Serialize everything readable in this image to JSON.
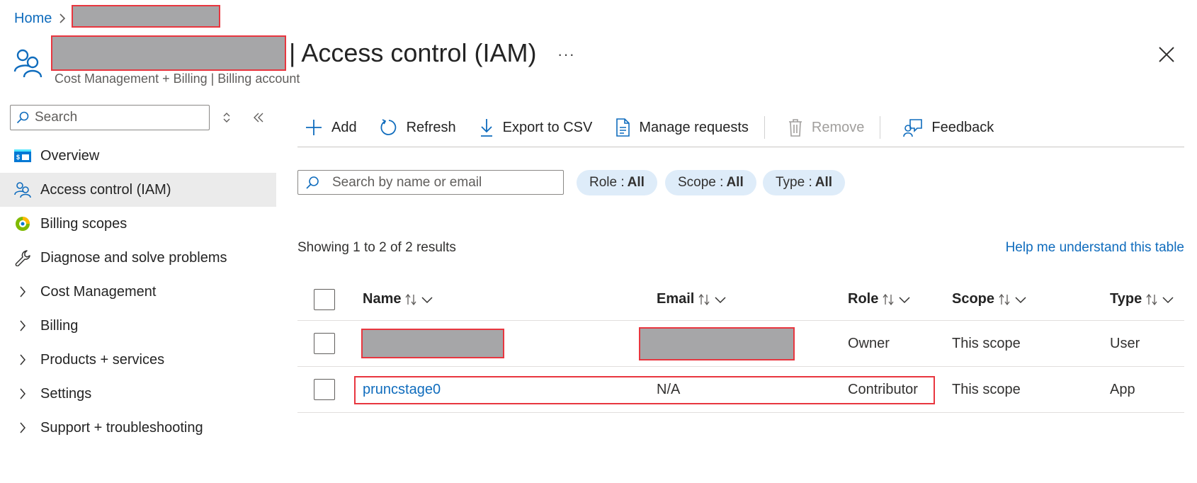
{
  "breadcrumb": {
    "home": "Home"
  },
  "header": {
    "title": "| Access control (IAM)",
    "more": "···",
    "subtitle": "Cost Management + Billing | Billing account"
  },
  "sidebar": {
    "search_placeholder": "Search",
    "items": [
      {
        "label": "Overview",
        "icon": "overview-icon"
      },
      {
        "label": "Access control (IAM)",
        "icon": "people-icon",
        "active": true
      },
      {
        "label": "Billing scopes",
        "icon": "billing-scopes-icon"
      },
      {
        "label": "Diagnose and solve problems",
        "icon": "wrench-icon"
      },
      {
        "label": "Cost Management",
        "icon": "chevron-right-icon"
      },
      {
        "label": "Billing",
        "icon": "chevron-right-icon"
      },
      {
        "label": "Products + services",
        "icon": "chevron-right-icon"
      },
      {
        "label": "Settings",
        "icon": "chevron-right-icon"
      },
      {
        "label": "Support + troubleshooting",
        "icon": "chevron-right-icon"
      }
    ]
  },
  "toolbar": {
    "add": "Add",
    "refresh": "Refresh",
    "export": "Export to CSV",
    "manage": "Manage requests",
    "remove": "Remove",
    "feedback": "Feedback"
  },
  "filters": {
    "search_placeholder": "Search by name or email",
    "role": {
      "label": "Role :",
      "value": "All"
    },
    "scope": {
      "label": "Scope :",
      "value": "All"
    },
    "type": {
      "label": "Type :",
      "value": "All"
    }
  },
  "results_text": "Showing 1 to 2 of 2 results",
  "help_link": "Help me understand this table",
  "table": {
    "headers": {
      "name": "Name",
      "email": "Email",
      "role": "Role",
      "scope": "Scope",
      "type": "Type"
    },
    "rows": [
      {
        "name": "",
        "email": "",
        "role": "Owner",
        "scope": "This scope",
        "type": "User"
      },
      {
        "name": "pruncstage0",
        "email": "N/A",
        "role": "Contributor",
        "scope": "This scope",
        "type": "App"
      }
    ]
  },
  "colors": {
    "accent": "#0f6cbd",
    "pill": "#deecf9",
    "active_nav": "#ebebeb",
    "redaction_border": "#e8363f"
  }
}
